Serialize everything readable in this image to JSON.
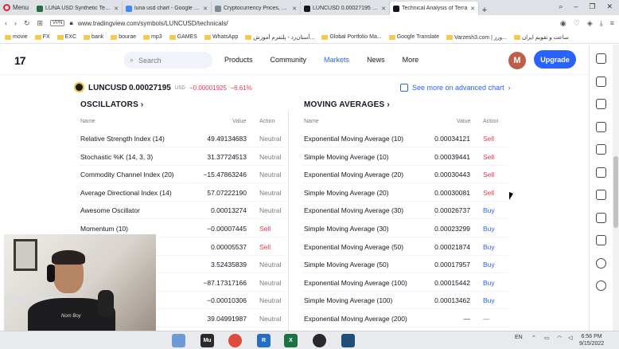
{
  "browser": {
    "menu_label": "Menu",
    "tabs": [
      {
        "title": "LUNA USD Synthetic Techn",
        "color": "#2c6a3f"
      },
      {
        "title": "luna usd chart - Google Se",
        "color": "#4285f4"
      },
      {
        "title": "Cryptocurrency Prices, Char",
        "color": "#7b8b99"
      },
      {
        "title": "LUNCUSD 0.00027195 ▼ -",
        "color": "#131722"
      },
      {
        "title": "Technical Analysis of Terra",
        "color": "#131722"
      }
    ],
    "vpn_label": "VPN",
    "url": "www.tradingview.com/symbols/LUNCUSD/technicals/",
    "bookmarks": [
      "movie",
      "FX",
      "EXC",
      "bank",
      "bourae",
      "mp3",
      "GAMES",
      "WhatsApp",
      "آستان‌رد - پلتفرم آموزش...",
      "Global Portfolio Ma...",
      "Google Translate",
      "Varzesh3.com | ورز...",
      "ساعت و تقویم ایران"
    ]
  },
  "header": {
    "logo": "17",
    "search_placeholder": "Search",
    "nav": [
      "Products",
      "Community",
      "Markets",
      "News",
      "More"
    ],
    "active_nav": "Markets",
    "avatar_letter": "M",
    "upgrade_label": "Upgrade"
  },
  "symbol": {
    "name": "LUNCUSD",
    "price": "0.00027195",
    "currency": "USD",
    "change": "−0.00001925",
    "change_pct": "−6.61%",
    "advanced_link": "See more on advanced chart"
  },
  "oscillators": {
    "title": "OSCILLATORS",
    "headers": {
      "name": "Name",
      "value": "Value",
      "action": "Action"
    },
    "rows": [
      {
        "name": "Relative Strength Index (14)",
        "value": "49.49134683",
        "action": "Neutral"
      },
      {
        "name": "Stochastic %K (14, 3, 3)",
        "value": "31.37724513",
        "action": "Neutral"
      },
      {
        "name": "Commodity Channel Index (20)",
        "value": "−15.47863246",
        "action": "Neutral"
      },
      {
        "name": "Average Directional Index (14)",
        "value": "57.07222190",
        "action": "Neutral"
      },
      {
        "name": "Awesome Oscillator",
        "value": "0.00013274",
        "action": "Neutral"
      },
      {
        "name": "Momentum (10)",
        "value": "−0.00007445",
        "action": "Sell"
      },
      {
        "name": "",
        "value": "0.00005537",
        "action": "Sell"
      },
      {
        "name": "3, 14, 14)",
        "value": "3.52435839",
        "action": "Neutral"
      },
      {
        "name": "(14)",
        "value": "−87.17317166",
        "action": "Neutral"
      },
      {
        "name": "",
        "value": "−0.00010306",
        "action": "Neutral"
      },
      {
        "name": "14, 28)",
        "value": "39.04991987",
        "action": "Neutral"
      }
    ]
  },
  "moving_averages": {
    "title": "MOVING AVERAGES",
    "headers": {
      "name": "Name",
      "value": "Value",
      "action": "Action"
    },
    "rows": [
      {
        "name": "Exponential Moving Average (10)",
        "value": "0.00034121",
        "action": "Sell"
      },
      {
        "name": "Simple Moving Average (10)",
        "value": "0.00039441",
        "action": "Sell"
      },
      {
        "name": "Exponential Moving Average (20)",
        "value": "0.00030443",
        "action": "Sell"
      },
      {
        "name": "Simple Moving Average (20)",
        "value": "0.00030081",
        "action": "Sell"
      },
      {
        "name": "Exponential Moving Average (30)",
        "value": "0.00026737",
        "action": "Buy"
      },
      {
        "name": "Simple Moving Average (30)",
        "value": "0.00023299",
        "action": "Buy"
      },
      {
        "name": "Exponential Moving Average (50)",
        "value": "0.00021874",
        "action": "Buy"
      },
      {
        "name": "Simple Moving Average (50)",
        "value": "0.00017957",
        "action": "Buy"
      },
      {
        "name": "Exponential Moving Average (100)",
        "value": "0.00015442",
        "action": "Buy"
      },
      {
        "name": "Simple Moving Average (100)",
        "value": "0.00013462",
        "action": "Buy"
      },
      {
        "name": "Exponential Moving Average (200)",
        "value": "—",
        "action": "—"
      }
    ]
  },
  "webcam": {
    "shirt_text": "Nom Boy"
  },
  "taskbar": {
    "apps": [
      {
        "name": "word-app",
        "label": "",
        "color": "#6d9bd6"
      },
      {
        "name": "muse-app",
        "label": "Mu",
        "color": "#2b2b2b"
      },
      {
        "name": "chrome-app",
        "label": "",
        "color": "#e04a3a"
      },
      {
        "name": "r-app",
        "label": "R",
        "color": "#276dc3"
      },
      {
        "name": "excel-app",
        "label": "X",
        "color": "#1e7145"
      },
      {
        "name": "obs-app",
        "label": "",
        "color": "#2a2a2a"
      },
      {
        "name": "misc-app",
        "label": "",
        "color": "#1f4e79"
      }
    ],
    "lang": "EN",
    "time": "6:56 PM",
    "date": "9/15/2022"
  }
}
